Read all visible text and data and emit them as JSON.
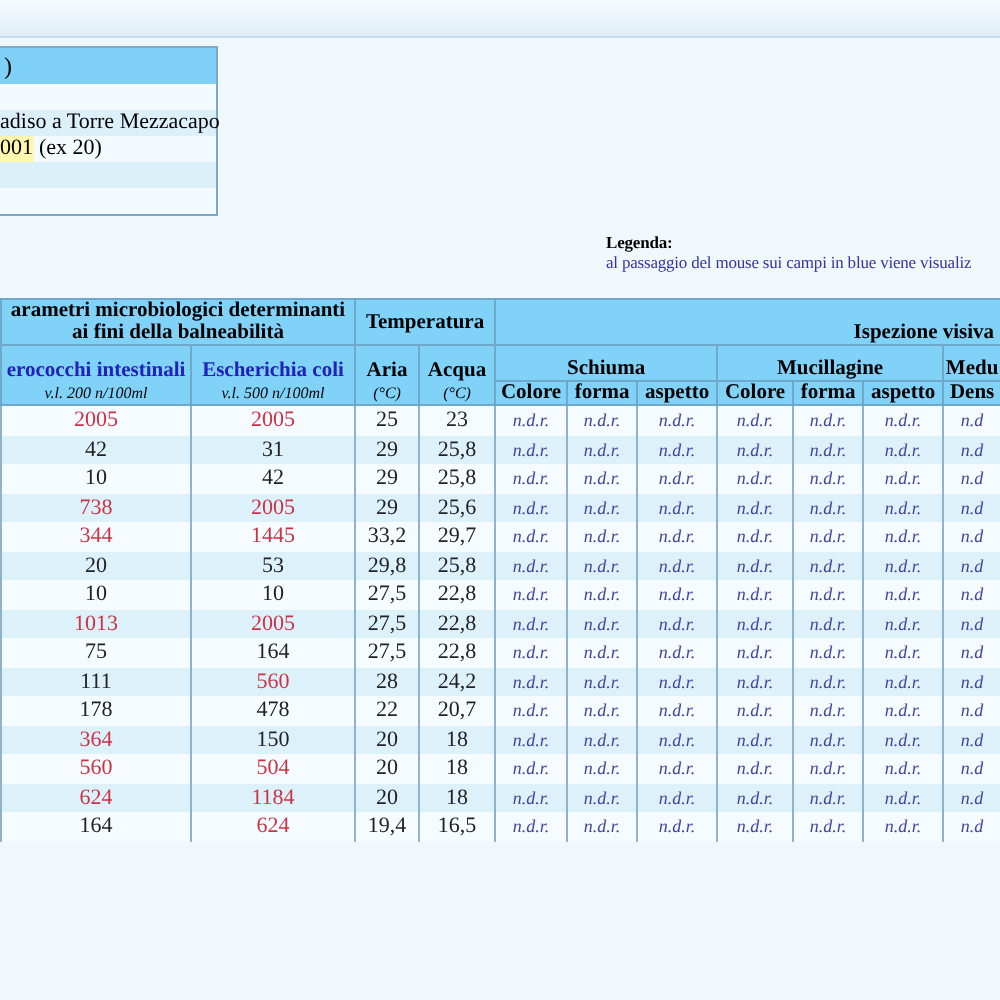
{
  "info_box": {
    "title": ")",
    "rows": [
      {
        "text": ""
      },
      {
        "text": "adiso a Torre Mezzacapo"
      },
      {
        "code": "001",
        "text": "(ex 20)"
      },
      {
        "text": ""
      },
      {
        "text": ""
      }
    ]
  },
  "legend": {
    "title": "Legenda:",
    "text": "al passaggio del mouse sui campi in blue viene visualiz"
  },
  "table": {
    "group_headers": [
      "arametri microbiologici determinanti ai fini della balneabilità",
      "Temperatura",
      "Ispezione visiva"
    ],
    "param_columns": [
      {
        "label": "erococchi intestinali",
        "limit": "v.l. 200 n/100ml"
      },
      {
        "label": "Escherichia coli",
        "limit": "v.l. 500 n/100ml"
      }
    ],
    "temp_columns": [
      {
        "label": "Aria",
        "unit": "(°C)"
      },
      {
        "label": "Acqua",
        "unit": "(°C)"
      }
    ],
    "inspection_groups": [
      "Schiuma",
      "Mucillagine",
      "Medu"
    ],
    "inspection_columns": [
      "Colore",
      "forma",
      "aspetto",
      "Colore",
      "forma",
      "aspetto",
      "Dens"
    ],
    "rows": [
      {
        "enterococchi": {
          "value": "2005",
          "exceeds": true
        },
        "escherichia": {
          "value": "2005",
          "exceeds": true
        },
        "aria": "25",
        "acqua": "23",
        "inspection": [
          "n.d.r.",
          "n.d.r.",
          "n.d.r.",
          "n.d.r.",
          "n.d.r.",
          "n.d.r.",
          "n.d"
        ]
      },
      {
        "enterococchi": {
          "value": "42",
          "exceeds": false
        },
        "escherichia": {
          "value": "31",
          "exceeds": false
        },
        "aria": "29",
        "acqua": "25,8",
        "inspection": [
          "n.d.r.",
          "n.d.r.",
          "n.d.r.",
          "n.d.r.",
          "n.d.r.",
          "n.d.r.",
          "n.d"
        ]
      },
      {
        "enterococchi": {
          "value": "10",
          "exceeds": false
        },
        "escherichia": {
          "value": "42",
          "exceeds": false
        },
        "aria": "29",
        "acqua": "25,8",
        "inspection": [
          "n.d.r.",
          "n.d.r.",
          "n.d.r.",
          "n.d.r.",
          "n.d.r.",
          "n.d.r.",
          "n.d"
        ]
      },
      {
        "enterococchi": {
          "value": "738",
          "exceeds": true
        },
        "escherichia": {
          "value": "2005",
          "exceeds": true
        },
        "aria": "29",
        "acqua": "25,6",
        "inspection": [
          "n.d.r.",
          "n.d.r.",
          "n.d.r.",
          "n.d.r.",
          "n.d.r.",
          "n.d.r.",
          "n.d"
        ]
      },
      {
        "enterococchi": {
          "value": "344",
          "exceeds": true
        },
        "escherichia": {
          "value": "1445",
          "exceeds": true
        },
        "aria": "33,2",
        "acqua": "29,7",
        "inspection": [
          "n.d.r.",
          "n.d.r.",
          "n.d.r.",
          "n.d.r.",
          "n.d.r.",
          "n.d.r.",
          "n.d"
        ]
      },
      {
        "enterococchi": {
          "value": "20",
          "exceeds": false
        },
        "escherichia": {
          "value": "53",
          "exceeds": false
        },
        "aria": "29,8",
        "acqua": "25,8",
        "inspection": [
          "n.d.r.",
          "n.d.r.",
          "n.d.r.",
          "n.d.r.",
          "n.d.r.",
          "n.d.r.",
          "n.d"
        ]
      },
      {
        "enterococchi": {
          "value": "10",
          "exceeds": false
        },
        "escherichia": {
          "value": "10",
          "exceeds": false
        },
        "aria": "27,5",
        "acqua": "22,8",
        "inspection": [
          "n.d.r.",
          "n.d.r.",
          "n.d.r.",
          "n.d.r.",
          "n.d.r.",
          "n.d.r.",
          "n.d"
        ]
      },
      {
        "enterococchi": {
          "value": "1013",
          "exceeds": true
        },
        "escherichia": {
          "value": "2005",
          "exceeds": true
        },
        "aria": "27,5",
        "acqua": "22,8",
        "inspection": [
          "n.d.r.",
          "n.d.r.",
          "n.d.r.",
          "n.d.r.",
          "n.d.r.",
          "n.d.r.",
          "n.d"
        ]
      },
      {
        "enterococchi": {
          "value": "75",
          "exceeds": false
        },
        "escherichia": {
          "value": "164",
          "exceeds": false
        },
        "aria": "27,5",
        "acqua": "22,8",
        "inspection": [
          "n.d.r.",
          "n.d.r.",
          "n.d.r.",
          "n.d.r.",
          "n.d.r.",
          "n.d.r.",
          "n.d"
        ]
      },
      {
        "enterococchi": {
          "value": "111",
          "exceeds": false
        },
        "escherichia": {
          "value": "560",
          "exceeds": true
        },
        "aria": "28",
        "acqua": "24,2",
        "inspection": [
          "n.d.r.",
          "n.d.r.",
          "n.d.r.",
          "n.d.r.",
          "n.d.r.",
          "n.d.r.",
          "n.d"
        ]
      },
      {
        "enterococchi": {
          "value": "178",
          "exceeds": false
        },
        "escherichia": {
          "value": "478",
          "exceeds": false
        },
        "aria": "22",
        "acqua": "20,7",
        "inspection": [
          "n.d.r.",
          "n.d.r.",
          "n.d.r.",
          "n.d.r.",
          "n.d.r.",
          "n.d.r.",
          "n.d"
        ]
      },
      {
        "enterococchi": {
          "value": "364",
          "exceeds": true
        },
        "escherichia": {
          "value": "150",
          "exceeds": false
        },
        "aria": "20",
        "acqua": "18",
        "inspection": [
          "n.d.r.",
          "n.d.r.",
          "n.d.r.",
          "n.d.r.",
          "n.d.r.",
          "n.d.r.",
          "n.d"
        ]
      },
      {
        "enterococchi": {
          "value": "560",
          "exceeds": true
        },
        "escherichia": {
          "value": "504",
          "exceeds": true
        },
        "aria": "20",
        "acqua": "18",
        "inspection": [
          "n.d.r.",
          "n.d.r.",
          "n.d.r.",
          "n.d.r.",
          "n.d.r.",
          "n.d.r.",
          "n.d"
        ]
      },
      {
        "enterococchi": {
          "value": "624",
          "exceeds": true
        },
        "escherichia": {
          "value": "1184",
          "exceeds": true
        },
        "aria": "20",
        "acqua": "18",
        "inspection": [
          "n.d.r.",
          "n.d.r.",
          "n.d.r.",
          "n.d.r.",
          "n.d.r.",
          "n.d.r.",
          "n.d"
        ]
      },
      {
        "enterococchi": {
          "value": "164",
          "exceeds": false
        },
        "escherichia": {
          "value": "624",
          "exceeds": true
        },
        "aria": "19,4",
        "acqua": "16,5",
        "inspection": [
          "n.d.r.",
          "n.d.r.",
          "n.d.r.",
          "n.d.r.",
          "n.d.r.",
          "n.d.r.",
          "n.d"
        ]
      }
    ]
  }
}
